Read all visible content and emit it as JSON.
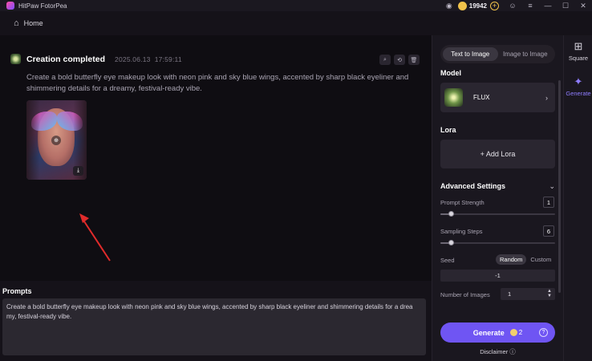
{
  "app": {
    "title": "HitPaw FotorPea"
  },
  "titlebar": {
    "credits": "19942",
    "icons": [
      "discord-icon",
      "coin-icon",
      "add-credits-icon",
      "account-icon",
      "menu-icon",
      "minimize-icon",
      "maximize-icon",
      "close-icon"
    ]
  },
  "nav": {
    "home_label": "Home"
  },
  "creation": {
    "status": "Creation completed",
    "date": "2025.06.13",
    "time": "17:59:11",
    "prompt": "Create a bold butterfly eye makeup look with neon pink and sky blue wings, accented by sharp black eyeliner and shimmering details for a dreamy, festival-ready vibe."
  },
  "prompts_panel": {
    "label": "Prompts",
    "text": "Create a bold butterfly eye makeup look with neon pink and sky blue wings, accented by sharp black eyeliner and shimmering details for a drea my, festival-ready vibe."
  },
  "settings": {
    "tabs": [
      {
        "label": "Text to Image",
        "active": true
      },
      {
        "label": "Image to Image",
        "active": false
      }
    ],
    "model_label": "Model",
    "model_name": "FLUX",
    "lora_label": "Lora",
    "add_lora": "+ Add Lora",
    "advanced_label": "Advanced Settings",
    "prompt_strength_label": "Prompt Strength",
    "prompt_strength_value": "1",
    "prompt_strength_level": 0.09,
    "sampling_steps_label": "Sampling Steps",
    "sampling_steps_value": "6",
    "sampling_steps_level": 0.09,
    "seed_label": "Seed",
    "seed_random": "Random",
    "seed_custom": "Custom",
    "seed_value": "-1",
    "num_images_label": "Number of Images",
    "num_images_value": "1",
    "generate_label": "Generate",
    "generate_cost": "2",
    "disclaimer": "Disclaimer"
  },
  "rail": {
    "square_label": "Square",
    "generate_label": "Generate"
  },
  "colors": {
    "accent": "#6f55f3",
    "rail_active": "#8f7dff",
    "arrow": "#e02b2b"
  }
}
